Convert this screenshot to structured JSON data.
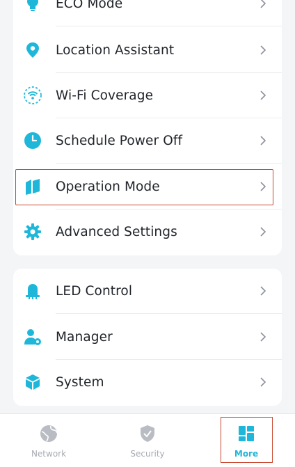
{
  "colors": {
    "accent": "#1fb7d9",
    "highlight_border": "#c9472e",
    "inactive_tab": "#a7abb2"
  },
  "group1": {
    "items": [
      {
        "label": "ECO Mode",
        "icon": "bulb-icon"
      },
      {
        "label": "Location Assistant",
        "icon": "location-pin-icon"
      },
      {
        "label": "Wi-Fi Coverage",
        "icon": "wifi-coverage-icon"
      },
      {
        "label": "Schedule Power Off",
        "icon": "clock-icon"
      },
      {
        "label": "Operation Mode",
        "icon": "operation-mode-icon"
      },
      {
        "label": "Advanced Settings",
        "icon": "gear-icon"
      }
    ]
  },
  "group2": {
    "items": [
      {
        "label": "LED Control",
        "icon": "bell-icon"
      },
      {
        "label": "Manager",
        "icon": "user-gear-icon"
      },
      {
        "label": "System",
        "icon": "cube-icon"
      }
    ]
  },
  "tabbar": {
    "tabs": [
      {
        "label": "Network",
        "icon": "globe-icon"
      },
      {
        "label": "Security",
        "icon": "shield-icon"
      },
      {
        "label": "More",
        "icon": "grid-icon",
        "active": true
      }
    ]
  }
}
